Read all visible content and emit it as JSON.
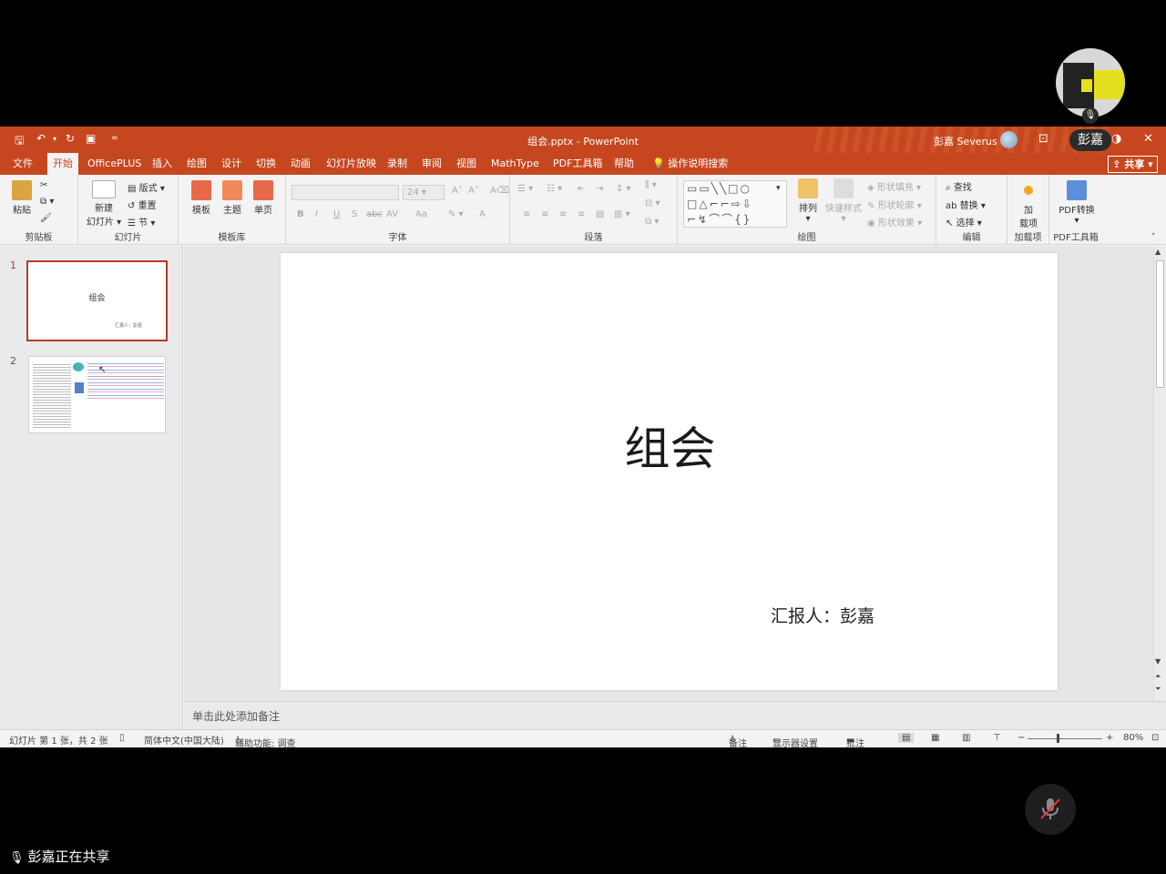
{
  "window": {
    "doc_title": "组会.pptx - PowerPoint",
    "user_name": "彭嘉 Severus"
  },
  "quick_access": {
    "save_icon": "save-icon",
    "undo_icon": "undo-icon",
    "redo_icon": "redo-icon",
    "present_icon": "present-from-start-icon",
    "customize": "="
  },
  "tabs": [
    {
      "label": "文件"
    },
    {
      "label": "开始"
    },
    {
      "label": "OfficePLUS"
    },
    {
      "label": "插入"
    },
    {
      "label": "绘图"
    },
    {
      "label": "设计"
    },
    {
      "label": "切换"
    },
    {
      "label": "动画"
    },
    {
      "label": "幻灯片放映"
    },
    {
      "label": "录制"
    },
    {
      "label": "审阅"
    },
    {
      "label": "视图"
    },
    {
      "label": "MathType"
    },
    {
      "label": "PDF工具箱"
    },
    {
      "label": "帮助"
    },
    {
      "label": "操作说明搜索"
    }
  ],
  "share_label": "共享",
  "ribbon": {
    "clipboard": {
      "paste": "粘贴",
      "name": "剪贴板"
    },
    "slides": {
      "new_line1": "新建",
      "new_line2": "幻灯片",
      "layout": "版式",
      "reset": "重置",
      "section": "节",
      "name": "幻灯片"
    },
    "templates": {
      "template": "模板",
      "theme": "主题",
      "single": "单页",
      "name": "模板库"
    },
    "font": {
      "size": "24",
      "bold": "B",
      "italic": "I",
      "underline": "U",
      "shadow": "S",
      "strike": "abc",
      "spacing": "AV",
      "case": "Aa",
      "color": "A",
      "name": "字体"
    },
    "paragraph": {
      "name": "段落"
    },
    "drawing": {
      "arrange": "排列",
      "quick_styles": "快速样式",
      "fill": "形状填充",
      "outline": "形状轮廓",
      "effect": "形状效果",
      "name": "绘图"
    },
    "editing": {
      "find": "查找",
      "replace": "替换",
      "select": "选择",
      "name": "编辑"
    },
    "addins": {
      "line1": "加",
      "line2": "载项",
      "name": "加载项"
    },
    "pdf": {
      "convert": "PDF转换",
      "name": "PDF工具箱"
    }
  },
  "thumbnails": [
    {
      "num": "1",
      "title": "组会",
      "sub": "汇报人：彭嘉"
    },
    {
      "num": "2"
    }
  ],
  "slide": {
    "title": "组会",
    "subtitle": "汇报人：彭嘉"
  },
  "notes_placeholder": "单击此处添加备注",
  "status": {
    "slide_info": "幻灯片 第 1 张，共 2 张",
    "language": "简体中文(中国大陆)",
    "accessibility": "辅助功能: 调查",
    "notes": "备注",
    "display_settings": "显示器设置",
    "comments": "批注",
    "zoom": "80%"
  },
  "meeting": {
    "presenter_name": "彭嘉",
    "sharing_text": "彭嘉正在共享"
  },
  "colors": {
    "accent": "#c6471f",
    "thumb_border": "#b33a2a"
  }
}
